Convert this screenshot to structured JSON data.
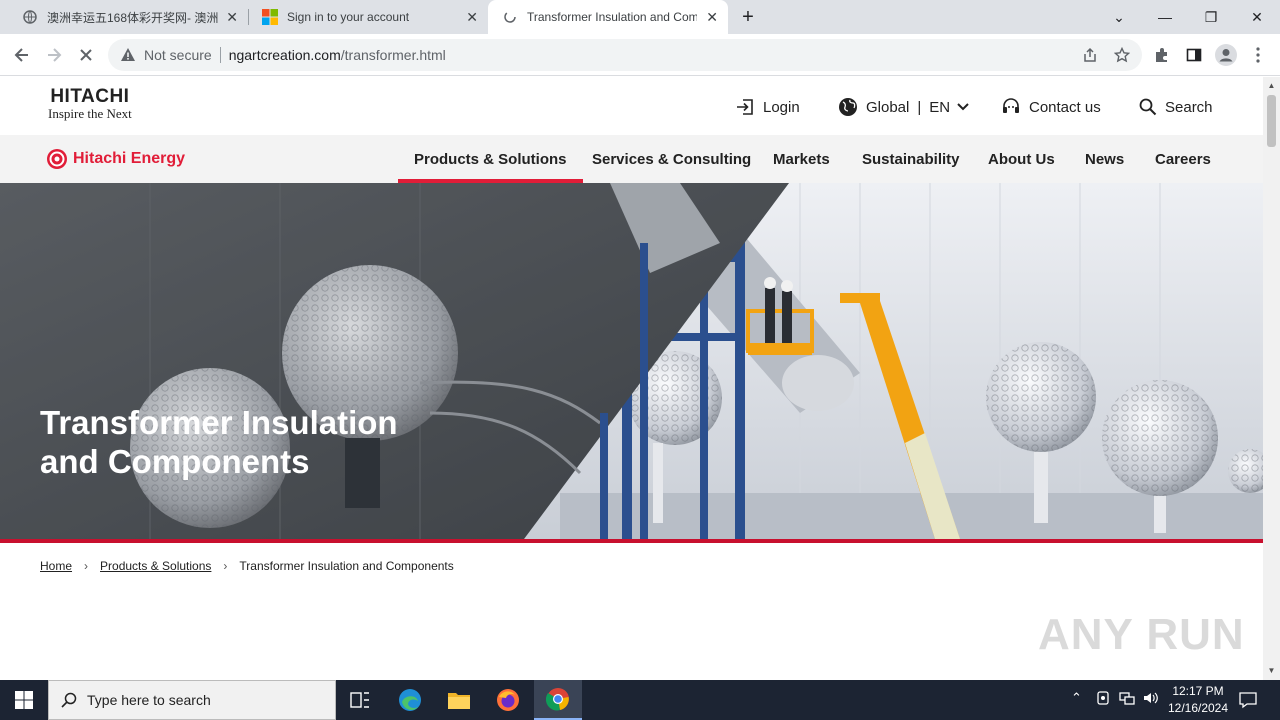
{
  "browser": {
    "tabs": [
      {
        "title": "澳洲幸运五168体彩开奖网- 澳洲",
        "active": false
      },
      {
        "title": "Sign in to your account",
        "active": false
      },
      {
        "title": "Transformer Insulation and Com",
        "active": true
      }
    ],
    "new_tab_icon": "plus-icon",
    "address": {
      "security_label": "Not secure",
      "host": "ngartcreation.com",
      "path": "/transformer.html"
    }
  },
  "site": {
    "brand": {
      "name": "HITACHI",
      "tagline": "Inspire the Next"
    },
    "utility": {
      "login": "Login",
      "region": "Global",
      "language": "EN",
      "contact": "Contact us",
      "search": "Search"
    },
    "sub_brand": "Hitachi Energy",
    "nav": [
      {
        "label": "Products & Solutions",
        "active": true
      },
      {
        "label": "Services & Consulting",
        "active": false
      },
      {
        "label": "Markets",
        "active": false
      },
      {
        "label": "Sustainability",
        "active": false
      },
      {
        "label": "About Us",
        "active": false
      },
      {
        "label": "News",
        "active": false
      },
      {
        "label": "Careers",
        "active": false
      }
    ],
    "hero": {
      "title_line1": "Transformer Insulation",
      "title_line2": "and Components"
    },
    "breadcrumb": [
      {
        "label": "Home",
        "link": true
      },
      {
        "label": "Products & Solutions",
        "link": true
      },
      {
        "label": "Transformer Insulation and Components",
        "link": false
      }
    ],
    "accent_color": "#e11d38"
  },
  "watermark": "ANY RUN",
  "taskbar": {
    "search_placeholder": "Type here to search",
    "time": "12:17 PM",
    "date": "12/16/2024"
  }
}
